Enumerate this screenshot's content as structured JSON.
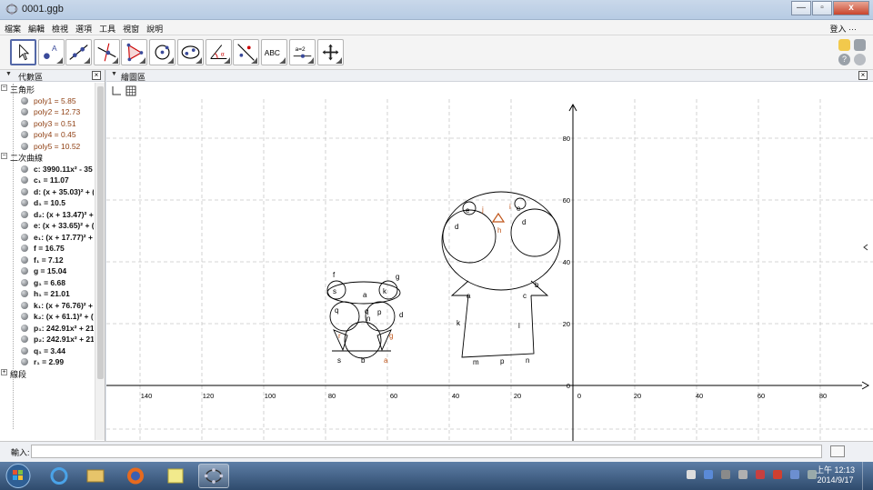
{
  "window": {
    "title": "0001.ggb",
    "buttons": [
      "—",
      "▫",
      "x"
    ]
  },
  "menu": {
    "items": [
      "檔案",
      "編輯",
      "檢視",
      "選項",
      "工具",
      "視窗",
      "說明"
    ],
    "login": "登入 ···"
  },
  "toolbar": {
    "tools": [
      {
        "name": "move-tool-icon",
        "active": true
      },
      {
        "name": "point-tool-icon"
      },
      {
        "name": "line-tool-icon"
      },
      {
        "name": "perpendicular-tool-icon"
      },
      {
        "name": "polygon-tool-icon"
      },
      {
        "name": "circle-tool-icon"
      },
      {
        "name": "ellipse-tool-icon"
      },
      {
        "name": "angle-tool-icon"
      },
      {
        "name": "reflect-tool-icon"
      },
      {
        "name": "text-tool-icon",
        "text": "ABC"
      },
      {
        "name": "slider-tool-icon",
        "text": "a=2"
      },
      {
        "name": "move-view-tool-icon"
      }
    ]
  },
  "algebra": {
    "title": "代數區",
    "groups": [
      {
        "label": "三角形",
        "color": "brown",
        "items": [
          "poly1 = 5.85",
          "poly2 = 12.73",
          "poly3 = 0.51",
          "poly4 = 0.45",
          "poly5 = 10.52"
        ]
      },
      {
        "label": "二次曲線",
        "color": "black",
        "items": [
          "c: 3990.11x² - 35",
          "c₁ = 11.07",
          "d: (x + 35.03)² + (",
          "d₁ = 10.5",
          "d₂: (x + 13.47)² +",
          "e: (x + 33.65)² + (",
          "e₁: (x + 17.77)² +",
          "f = 16.75",
          "f₁ = 7.12",
          "g = 15.04",
          "g₁ = 6.68",
          "h₁ = 21.01",
          "k₁: (x + 76.76)² +",
          "k₂: (x + 61.1)² + (",
          "p₁: 242.91x² + 21",
          "p₂: 242.91x² + 21",
          "q₁ = 3.44",
          "r₁ = 2.99"
        ]
      },
      {
        "label": "線段",
        "color": "black",
        "items": []
      }
    ]
  },
  "graphics": {
    "title": "繪圖區",
    "x_ticks": [
      "140",
      "120",
      "100",
      "80",
      "60",
      "40",
      "20",
      "0",
      "20",
      "40",
      "60",
      "80"
    ],
    "y_ticks": [
      "80",
      "60",
      "40",
      "20",
      "0"
    ],
    "labels": {
      "f": "f",
      "g": "g",
      "a": "a",
      "s": "s",
      "k2": "k",
      "q": "q",
      "p": "p",
      "n": "n",
      "d1": "d",
      "s1": "s",
      "b": "b",
      "a2": "a",
      "r": "r",
      "g1": "g",
      "e": "e",
      "j": "j",
      "i": "i",
      "e1": "e",
      "d": "d",
      "h": "h",
      "d2": "d",
      "a1": "a",
      "b3": "b",
      "c3": "c",
      "k": "k",
      "l": "l",
      "m": "m",
      "p2": "p",
      "n2": "n"
    }
  },
  "input": {
    "label": "輸入:",
    "value": ""
  },
  "taskbar": {
    "time": "上午 12:13",
    "date": "2014/9/17"
  },
  "colors": {
    "accent": "#5468a8",
    "brown": "#8f3f12",
    "orange": "#c0571c"
  }
}
